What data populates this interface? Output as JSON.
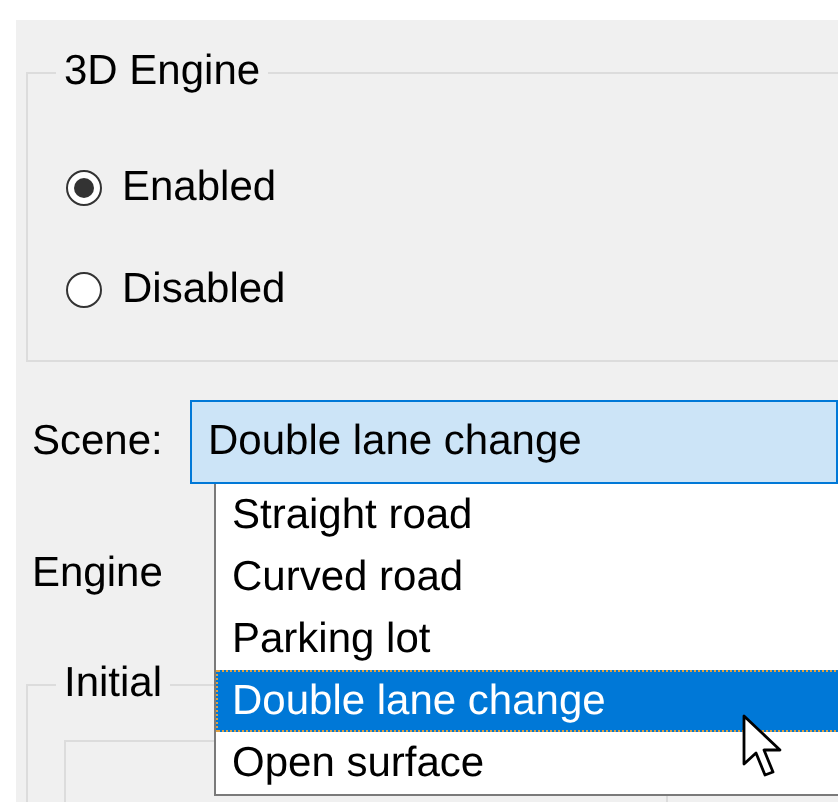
{
  "group": {
    "title": "3D Engine",
    "options": [
      {
        "label": "Enabled",
        "selected": true
      },
      {
        "label": "Disabled",
        "selected": false
      }
    ]
  },
  "scene": {
    "label": "Scene:",
    "value": "Double lane change",
    "expanded": true,
    "options": [
      {
        "label": "Straight road",
        "selected": false
      },
      {
        "label": "Curved road",
        "selected": false
      },
      {
        "label": "Parking lot",
        "selected": false
      },
      {
        "label": "Double lane change",
        "selected": true
      },
      {
        "label": "Open surface",
        "selected": false
      }
    ]
  },
  "engine_label": "Engine",
  "initial_group": {
    "title": "Initial"
  }
}
